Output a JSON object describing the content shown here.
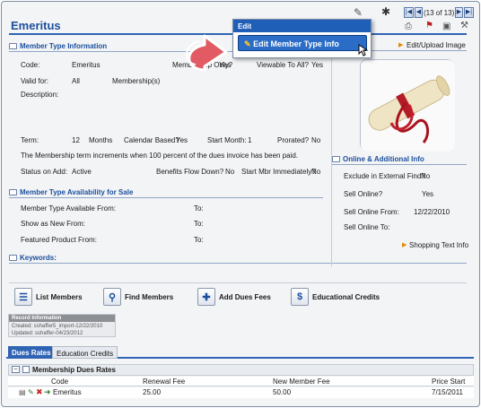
{
  "header": {
    "title": "Emeritus",
    "record_counter": "(13 of 13)",
    "nav": {
      "first": "|◀",
      "prev": "◀",
      "next": "▶",
      "last": "▶|"
    },
    "edit_upload_image": "Edit/Upload Image"
  },
  "edit_menu": {
    "heading": "Edit",
    "item": "Edit Member Type Info"
  },
  "member_type_info": {
    "section_title": "Member Type Information",
    "code_label": "Code:",
    "code_value": "Emeritus",
    "membership_only_label": "Membership Only?",
    "membership_only_value": "Yes",
    "viewable_label": "Viewable To All?",
    "viewable_value": "Yes",
    "valid_for_label": "Valid for:",
    "valid_for_value": "All",
    "valid_for_unit": "Membership(s)",
    "description_label": "Description:",
    "term_label": "Term:",
    "term_value": "12",
    "term_unit": "Months",
    "calendar_label": "Calendar Based?",
    "calendar_value": "Yes",
    "start_month_label": "Start Month:",
    "start_month_value": "1",
    "prorated_label": "Prorated?",
    "prorated_value": "No",
    "increment_text": "The Membership term increments when 100  percent of the dues invoice has been paid.",
    "status_label": "Status on Add:",
    "status_value": "Active",
    "benefits_label": "Benefits Flow Down?",
    "benefits_value": "No",
    "start_mbr_label": "Start Mbr Immediately?",
    "start_mbr_value": "No"
  },
  "availability": {
    "section_title": "Member Type Availability for Sale",
    "available_from": "Member Type Available From:",
    "new_from": "Show as New From:",
    "featured_from": "Featured Product From:",
    "to_label": "To:"
  },
  "keywords": {
    "section_title": "Keywords:"
  },
  "online": {
    "section_title": "Online & Additional Info",
    "exclude_label": "Exclude in External Find?",
    "exclude_value": "No",
    "sell_online_label": "Sell Online?",
    "sell_online_value": "Yes",
    "sell_from_label": "Sell Online From:",
    "sell_from_value": "12/22/2010",
    "sell_to_label": "Sell Online To:",
    "shopping_text": "Shopping Text Info"
  },
  "actions": {
    "list_members": "List Members",
    "find_members": "Find Members",
    "add_dues_fees": "Add Dues Fees",
    "educational_credits": "Educational Credits"
  },
  "record_info": {
    "title": "Record Information",
    "created": "Created: sshaffer5_import-12/22/2010",
    "updated": "Updated: sshaffer-04/23/2012"
  },
  "tabs": [
    "Dues Rates",
    "Education Credits"
  ],
  "dues_grid": {
    "title": "Membership Dues Rates",
    "columns": [
      "Code",
      "Renewal Fee",
      "New Member Fee",
      "Price Start"
    ],
    "rows": [
      {
        "code": "Emeritus",
        "renewal_fee": "25.00",
        "new_member_fee": "50.00",
        "price_start": "7/15/2011"
      }
    ]
  },
  "colors": {
    "accent": "#1f5fb8",
    "title": "#1b4f9c",
    "callout_arrow": "#e25a63"
  }
}
